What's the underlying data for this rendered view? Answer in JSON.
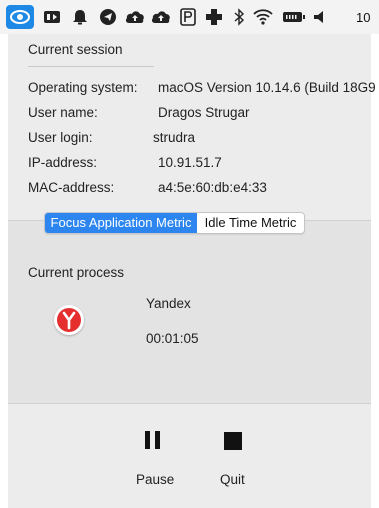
{
  "menubar": {
    "icons": [
      "eye-icon",
      "video-icon",
      "notification-bell-icon",
      "telegram-icon",
      "cloud-upload-icon",
      "cloud-upload-icon",
      "parking-icon",
      "medical-cross-icon",
      "bluetooth-icon",
      "wifi-icon",
      "battery-icon",
      "volume-icon"
    ],
    "clock_text": "10"
  },
  "session": {
    "title": "Current session",
    "rows": [
      {
        "label": "Operating system:",
        "value": "macOS Version 10.14.6 (Build 18G9"
      },
      {
        "label": "User name:",
        "value": "Dragos Strugar"
      },
      {
        "label": "User login:",
        "value": "strudra"
      },
      {
        "label": "IP-address:",
        "value": "10.91.51.7"
      },
      {
        "label": "MAC-address:",
        "value": "a4:5e:60:db:e4:33"
      }
    ]
  },
  "metrics": {
    "tabs": [
      {
        "label": "Focus Application Metric",
        "active": true
      },
      {
        "label": "Idle Time Metric",
        "active": false
      }
    ]
  },
  "process": {
    "title": "Current process",
    "app_name": "Yandex",
    "app_icon": "yandex-browser-icon",
    "elapsed": "00:01:05"
  },
  "controls": {
    "pause_label": "Pause",
    "quit_label": "Quit"
  },
  "colors": {
    "accent": "#2d86f0",
    "panel_bg": "#ececec",
    "yandex_red": "#e52e2e"
  }
}
